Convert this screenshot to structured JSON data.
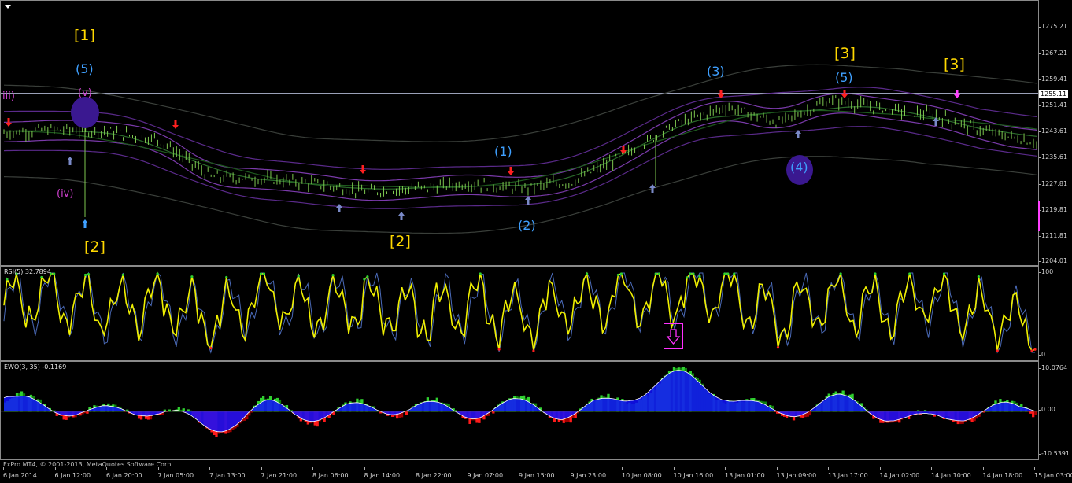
{
  "chart": {
    "copyright": "FxPro MT4, © 2001-2013, MetaQuotes Software Corp.",
    "current_price": "1255.11",
    "colors": {
      "candle": "#7ec850",
      "up_arrow": "#7a8ac8",
      "down_arrow": "#ff2020",
      "ma_purple": "#6a2a9a",
      "ma_green": "#2a6a2a",
      "envelope": "#3a3a3a"
    }
  },
  "price_axis": [
    "1275.21",
    "1267.21",
    "1259.41",
    "1251.41",
    "1243.61",
    "1235.61",
    "1227.81",
    "1219.81",
    "1211.81",
    "1204.01"
  ],
  "time_axis": [
    "6 Jan 2014",
    "6 Jan 12:00",
    "6 Jan 20:00",
    "7 Jan 05:00",
    "7 Jan 13:00",
    "7 Jan 21:00",
    "8 Jan 06:00",
    "8 Jan 14:00",
    "8 Jan 22:00",
    "9 Jan 07:00",
    "9 Jan 15:00",
    "9 Jan 23:00",
    "10 Jan 08:00",
    "10 Jan 16:00",
    "13 Jan 01:00",
    "13 Jan 09:00",
    "13 Jan 17:00",
    "14 Jan 02:00",
    "14 Jan 10:00",
    "14 Jan 18:00",
    "15 Jan 03:00"
  ],
  "wave_labels": {
    "yellow": [
      "[1]",
      "[2]",
      "[2]",
      "[3]",
      "[3]"
    ],
    "blue": [
      "(5)",
      "(1)",
      "(2)",
      "(3)",
      "(5)",
      "(4)"
    ],
    "magenta": [
      "iii)",
      "(v)",
      "(iv)"
    ]
  },
  "rsi": {
    "title": "RSI(5) 32.7894",
    "levels": [
      "100",
      "0"
    ]
  },
  "ewo": {
    "title": "EWO(3, 35) -0.1169",
    "levels": [
      "10.0764",
      "0.00",
      "-10.5391"
    ]
  },
  "chart_data": [
    {
      "type": "line",
      "title": "",
      "x": [
        "6 Jan 2014",
        "6 Jan 12:00",
        "6 Jan 20:00",
        "7 Jan 05:00",
        "7 Jan 13:00",
        "7 Jan 21:00",
        "8 Jan 06:00",
        "8 Jan 14:00",
        "8 Jan 22:00",
        "9 Jan 07:00",
        "9 Jan 15:00",
        "9 Jan 23:00",
        "10 Jan 08:00",
        "10 Jan 16:00",
        "13 Jan 01:00",
        "13 Jan 09:00",
        "13 Jan 17:00",
        "14 Jan 02:00",
        "14 Jan 10:00",
        "14 Jan 18:00",
        "15 Jan 03:00"
      ],
      "series": [
        {
          "values": [
            1243,
            1244,
            1243.5,
            1241,
            1229.5,
            1229,
            1227.5,
            1225,
            1226,
            1227.5,
            1226,
            1228,
            1236,
            1245.5,
            1251,
            1246,
            1253,
            1250.5,
            1248.5,
            1243.5,
            1240
          ]
        }
      ],
      "ylim": [
        1204.01,
        1275.21
      ]
    },
    {
      "type": "line",
      "title": "",
      "series": [
        {
          "values": [
            58,
            72,
            55,
            64,
            40,
            70,
            55,
            65,
            50,
            60,
            45,
            62,
            70,
            72,
            80,
            45,
            68,
            55,
            70,
            48,
            32.7894
          ]
        }
      ],
      "ylim": [
        0,
        100
      ]
    },
    {
      "type": "bar",
      "title": "",
      "series": [
        {
          "values": [
            2.5,
            1,
            -0.5,
            1.2,
            -5,
            1.5,
            -1,
            0.8,
            1.2,
            -0.5,
            1.8,
            -0.8,
            3,
            8.5,
            4.5,
            -1.5,
            3.5,
            -0.5,
            -2.5,
            1,
            -0.1169
          ]
        }
      ],
      "ylim": [
        -10.5391,
        10.0764
      ]
    }
  ]
}
